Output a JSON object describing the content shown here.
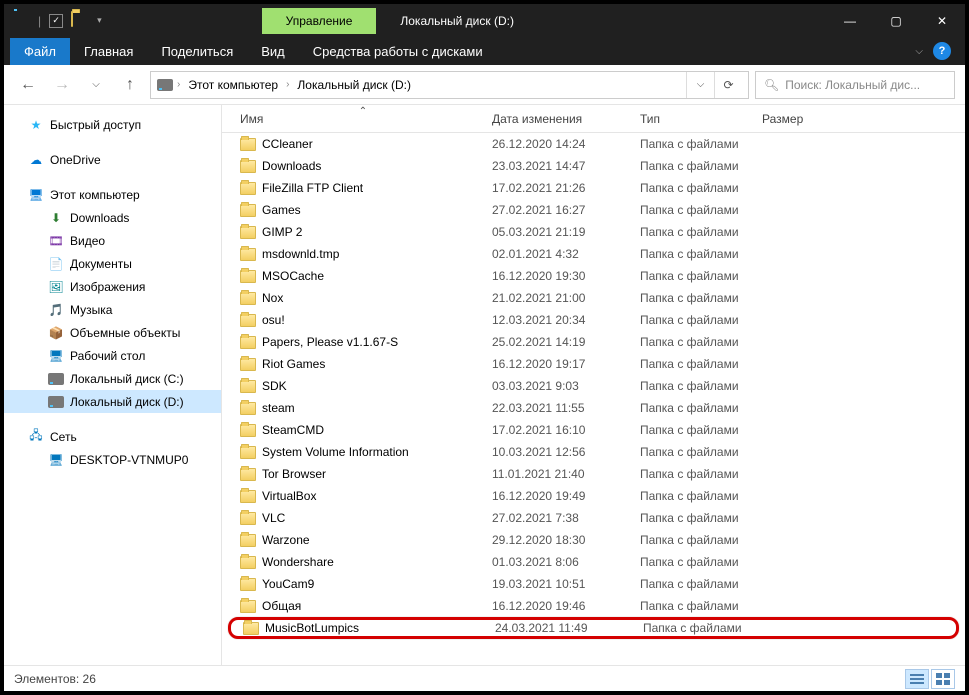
{
  "title_tab_mgmt": "Управление",
  "title_tab_name": "Локальный диск (D:)",
  "ribbon": {
    "file": "Файл",
    "home": "Главная",
    "share": "Поделиться",
    "view": "Вид",
    "tools": "Средства работы с дисками"
  },
  "breadcrumb": {
    "root": "Этот компьютер",
    "loc": "Локальный диск (D:)"
  },
  "search_placeholder": "Поиск: Локальный дис...",
  "columns": {
    "name": "Имя",
    "date": "Дата изменения",
    "type": "Тип",
    "size": "Размер"
  },
  "nav": {
    "quick": "Быстрый доступ",
    "onedrive": "OneDrive",
    "thispc": "Этот компьютер",
    "downloads": "Downloads",
    "video": "Видео",
    "documents": "Документы",
    "pictures": "Изображения",
    "music": "Музыка",
    "objects3d": "Объемные объекты",
    "desktop": "Рабочий стол",
    "diskC": "Локальный диск (C:)",
    "diskD": "Локальный диск (D:)",
    "network": "Сеть",
    "netpc": "DESKTOP-VTNMUP0"
  },
  "files": [
    {
      "name": "CCleaner",
      "date": "26.12.2020 14:24",
      "type": "Папка с файлами"
    },
    {
      "name": "Downloads",
      "date": "23.03.2021 14:47",
      "type": "Папка с файлами"
    },
    {
      "name": "FileZilla FTP Client",
      "date": "17.02.2021 21:26",
      "type": "Папка с файлами"
    },
    {
      "name": "Games",
      "date": "27.02.2021 16:27",
      "type": "Папка с файлами"
    },
    {
      "name": "GIMP 2",
      "date": "05.03.2021 21:19",
      "type": "Папка с файлами"
    },
    {
      "name": "msdownld.tmp",
      "date": "02.01.2021 4:32",
      "type": "Папка с файлами"
    },
    {
      "name": "MSOCache",
      "date": "16.12.2020 19:30",
      "type": "Папка с файлами"
    },
    {
      "name": "Nox",
      "date": "21.02.2021 21:00",
      "type": "Папка с файлами"
    },
    {
      "name": "osu!",
      "date": "12.03.2021 20:34",
      "type": "Папка с файлами"
    },
    {
      "name": "Papers, Please v1.1.67-S",
      "date": "25.02.2021 14:19",
      "type": "Папка с файлами"
    },
    {
      "name": "Riot Games",
      "date": "16.12.2020 19:17",
      "type": "Папка с файлами"
    },
    {
      "name": "SDK",
      "date": "03.03.2021 9:03",
      "type": "Папка с файлами"
    },
    {
      "name": "steam",
      "date": "22.03.2021 11:55",
      "type": "Папка с файлами"
    },
    {
      "name": "SteamCMD",
      "date": "17.02.2021 16:10",
      "type": "Папка с файлами"
    },
    {
      "name": "System Volume Information",
      "date": "10.03.2021 12:56",
      "type": "Папка с файлами"
    },
    {
      "name": "Tor Browser",
      "date": "11.01.2021 21:40",
      "type": "Папка с файлами"
    },
    {
      "name": "VirtualBox",
      "date": "16.12.2020 19:49",
      "type": "Папка с файлами"
    },
    {
      "name": "VLC",
      "date": "27.02.2021 7:38",
      "type": "Папка с файлами"
    },
    {
      "name": "Warzone",
      "date": "29.12.2020 18:30",
      "type": "Папка с файлами"
    },
    {
      "name": "Wondershare",
      "date": "01.03.2021 8:06",
      "type": "Папка с файлами"
    },
    {
      "name": "YouCam9",
      "date": "19.03.2021 10:51",
      "type": "Папка с файлами"
    },
    {
      "name": "Общая",
      "date": "16.12.2020 19:46",
      "type": "Папка с файлами"
    },
    {
      "name": "MusicBotLumpics",
      "date": "24.03.2021 11:49",
      "type": "Папка с файлами",
      "hl": true
    }
  ],
  "status": "Элементов: 26"
}
